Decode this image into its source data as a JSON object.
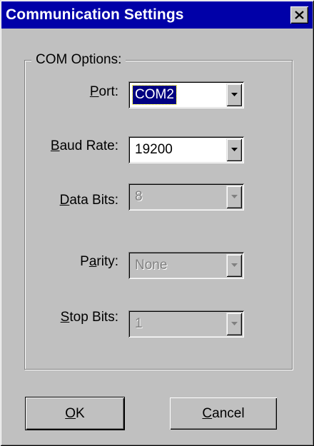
{
  "window": {
    "title": "Communication Settings",
    "close_glyph": "close-icon"
  },
  "group": {
    "legend": "COM Options:"
  },
  "fields": {
    "port": {
      "label_pre": "",
      "label_key": "P",
      "label_post": "ort:",
      "value": "COM2",
      "enabled": true,
      "focused": true
    },
    "baud_rate": {
      "label_pre": "",
      "label_key": "B",
      "label_post": "aud Rate:",
      "value": "19200",
      "enabled": true,
      "focused": false
    },
    "data_bits": {
      "label_pre": "",
      "label_key": "D",
      "label_post": "ata Bits:",
      "value": "8",
      "enabled": false,
      "focused": false
    },
    "parity": {
      "label_pre": "P",
      "label_key": "a",
      "label_post": "rity:",
      "value": "None",
      "enabled": false,
      "focused": false
    },
    "stop_bits": {
      "label_pre": "",
      "label_key": "S",
      "label_post": "top Bits:",
      "value": "1",
      "enabled": false,
      "focused": false
    }
  },
  "buttons": {
    "ok": {
      "key": "O",
      "rest": "K"
    },
    "cancel": {
      "key": "C",
      "rest": "ancel"
    }
  },
  "colors": {
    "titlebar": "#0000a8",
    "face": "#c0c0c0",
    "selection": "#000080"
  }
}
